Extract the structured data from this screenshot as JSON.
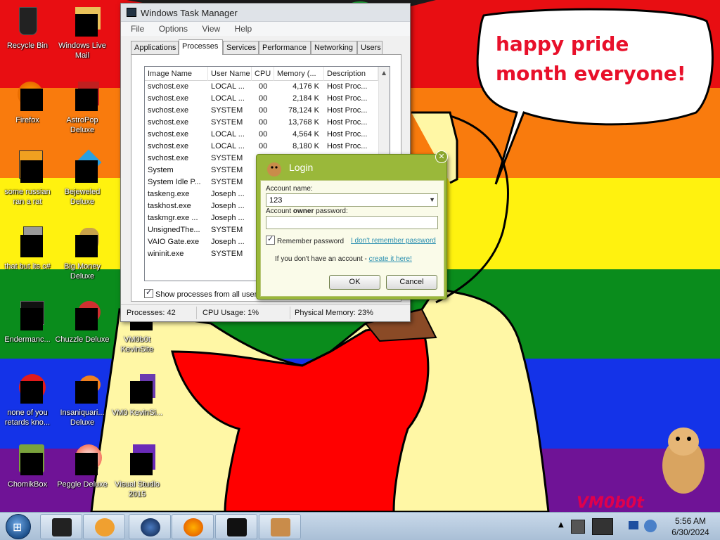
{
  "wallpaper": {
    "stripe_colors": [
      "#e80e12",
      "#f97b0d",
      "#fff20f",
      "#0a8c1c",
      "#1433e8",
      "#6f1396"
    ],
    "bubble_text": "happy pride month everyone!",
    "signature": "VM0b0t"
  },
  "desktop_icons": [
    {
      "label": "Recycle Bin",
      "icon": "recycle-bin-icon"
    },
    {
      "label": "Windows Live Mail",
      "icon": "mail-icon"
    },
    {
      "label": "Firefox",
      "icon": "firefox-icon"
    },
    {
      "label": "AstroPop Deluxe",
      "icon": "astropop-icon"
    },
    {
      "label": "some russian ran a rat",
      "icon": "java-icon"
    },
    {
      "label": "Bejeweled Deluxe",
      "icon": "bejeweled-icon"
    },
    {
      "label": "that but its c#",
      "icon": "generic-app-icon"
    },
    {
      "label": "Big Money Deluxe",
      "icon": "big-money-icon"
    },
    {
      "label": "Endermanc...",
      "icon": "window-icon"
    },
    {
      "label": "Chuzzle Deluxe",
      "icon": "chuzzle-icon"
    },
    {
      "label": "VM0b0t KevinSite",
      "icon": "file-icon"
    },
    {
      "label": "none of you retards kno...",
      "icon": "opera-icon"
    },
    {
      "label": "Insaniquari... Deluxe",
      "icon": "insaniquarium-icon"
    },
    {
      "label": "VM0 KevinSi...",
      "icon": "file-icon"
    },
    {
      "label": "ChomikBox",
      "icon": "chomikbox-icon"
    },
    {
      "label": "Peggle Deluxe",
      "icon": "peggle-icon"
    },
    {
      "label": "Visual Studio 2015",
      "icon": "visual-studio-icon"
    }
  ],
  "task_manager": {
    "title": "Windows Task Manager",
    "menu": [
      "File",
      "Options",
      "View",
      "Help"
    ],
    "tabs": [
      "Applications",
      "Processes",
      "Services",
      "Performance",
      "Networking",
      "Users"
    ],
    "active_tab": "Processes",
    "columns": [
      "Image Name",
      "User Name",
      "CPU",
      "Memory (...",
      "Description"
    ],
    "rows": [
      [
        "svchost.exe",
        "LOCAL ...",
        "00",
        "4,176 K",
        "Host Proc..."
      ],
      [
        "svchost.exe",
        "LOCAL ...",
        "00",
        "2,184 K",
        "Host Proc..."
      ],
      [
        "svchost.exe",
        "SYSTEM",
        "00",
        "78,124 K",
        "Host Proc..."
      ],
      [
        "svchost.exe",
        "SYSTEM",
        "00",
        "13,768 K",
        "Host Proc..."
      ],
      [
        "svchost.exe",
        "LOCAL ...",
        "00",
        "4,564 K",
        "Host Proc..."
      ],
      [
        "svchost.exe",
        "LOCAL ...",
        "00",
        "8,180 K",
        "Host Proc..."
      ],
      [
        "svchost.exe",
        "SYSTEM",
        "",
        "",
        ""
      ],
      [
        "System",
        "SYSTEM",
        "",
        "",
        ""
      ],
      [
        "System Idle P...",
        "SYSTEM",
        "",
        "",
        ""
      ],
      [
        "taskeng.exe",
        "Joseph ...",
        "",
        "",
        ""
      ],
      [
        "taskhost.exe",
        "Joseph ...",
        "",
        "",
        ""
      ],
      [
        "taskmgr.exe ...",
        "Joseph ...",
        "",
        "",
        ""
      ],
      [
        "UnsignedThe...",
        "SYSTEM",
        "",
        "",
        ""
      ],
      [
        "VAIO Gate.exe",
        "Joseph ...",
        "",
        "",
        ""
      ],
      [
        "wininit.exe",
        "SYSTEM",
        "",
        "",
        ""
      ]
    ],
    "show_all_label": "Show processes from all users",
    "status": {
      "processes": "Processes: 42",
      "cpu": "CPU Usage: 1%",
      "memory": "Physical Memory: 23%"
    }
  },
  "login": {
    "title": "Login",
    "account_label": "Account name:",
    "account_value": "123",
    "password_label_pre": "Account ",
    "password_label_bold": "owner",
    "password_label_post": " password:",
    "password_value": "",
    "remember_label": "Remember password",
    "forgot_link": "I don't remember password",
    "no_account_text": "If you don't have an account - ",
    "create_link": "create it here!",
    "ok_label": "OK",
    "cancel_label": "Cancel"
  },
  "taskbar": {
    "pinned": [
      "explorer",
      "media-player",
      "globe",
      "firefox",
      "task-manager",
      "chomikbox"
    ],
    "time": "5:56 AM",
    "date": "6/30/2024"
  }
}
